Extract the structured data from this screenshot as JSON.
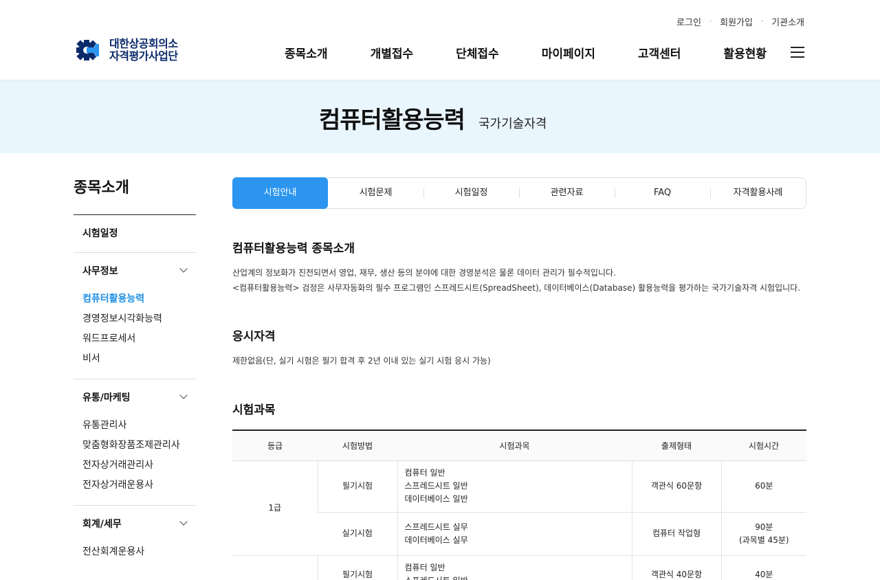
{
  "util": {
    "login": "로그인",
    "join": "회원가입",
    "about": "기관소개"
  },
  "logo": {
    "line1": "대한상공회의소",
    "line2": "자격평가사업단"
  },
  "gnb": [
    "종목소개",
    "개별접수",
    "단체접수",
    "마이페이지",
    "고객센터",
    "활용현황"
  ],
  "banner": {
    "title": "컴퓨터활용능력",
    "subtitle": "국가기술자격"
  },
  "sidebar": {
    "title": "종목소개",
    "groups": [
      {
        "label": "시험일정",
        "items": []
      },
      {
        "label": "사무정보",
        "items": [
          "컴퓨터활용능력",
          "경영정보시각화능력",
          "워드프로세서",
          "비서"
        ]
      },
      {
        "label": "유통/마케팅",
        "items": [
          "유통관리사",
          "맞춤형화장품조제관리사",
          "전자상거래관리사",
          "전자상거래운용사"
        ]
      },
      {
        "label": "회계/세무",
        "items": [
          "전산회계운용사"
        ]
      }
    ]
  },
  "tabs": [
    "시험안내",
    "시험문제",
    "시험일정",
    "관련자료",
    "FAQ",
    "자격활용사례"
  ],
  "intro": {
    "title": "컴퓨터활용능력 종목소개",
    "line1": "산업계의 정보화가 진전되면서 영업, 재무, 생산 등의 분야에 대한 경영분석은 물론 데이터 관리가 필수적입니다.",
    "line2": "<컴퓨터활용능력> 검정은 사무자동화의 필수 프로그램인 스프레드시트(SpreadSheet), 데이터베이스(Database) 활용능력을 평가하는 국가기술자격 시험입니다."
  },
  "qualification": {
    "title": "응시자격",
    "text": "제한없음(단, 실기 시험은 필기 합격 후 2년 이내 있는 실기 시험 응시 가능)"
  },
  "subjects": {
    "title": "시험과목",
    "headers": [
      "등급",
      "시험방법",
      "시험과목",
      "출제형태",
      "시험시간"
    ],
    "rows": [
      {
        "grade": "1급",
        "method": "필기시험",
        "subjects": [
          "컴퓨터 일반",
          "스프레드시트 일반",
          "데이터베이스 일반"
        ],
        "format": "객관식 60문항",
        "time": [
          "60분"
        ]
      },
      {
        "grade": "",
        "method": "실기시험",
        "subjects": [
          "스프레드시트 실무",
          "데이터베이스 실무"
        ],
        "format": "컴퓨터 작업형",
        "time": [
          "90분",
          "(과목별 45분)"
        ]
      },
      {
        "grade": "",
        "method": "필기시험",
        "subjects": [
          "컴퓨터 일반",
          "스프레드시트 일반"
        ],
        "format": "객관식 40문항",
        "time": [
          "40분"
        ]
      }
    ]
  }
}
